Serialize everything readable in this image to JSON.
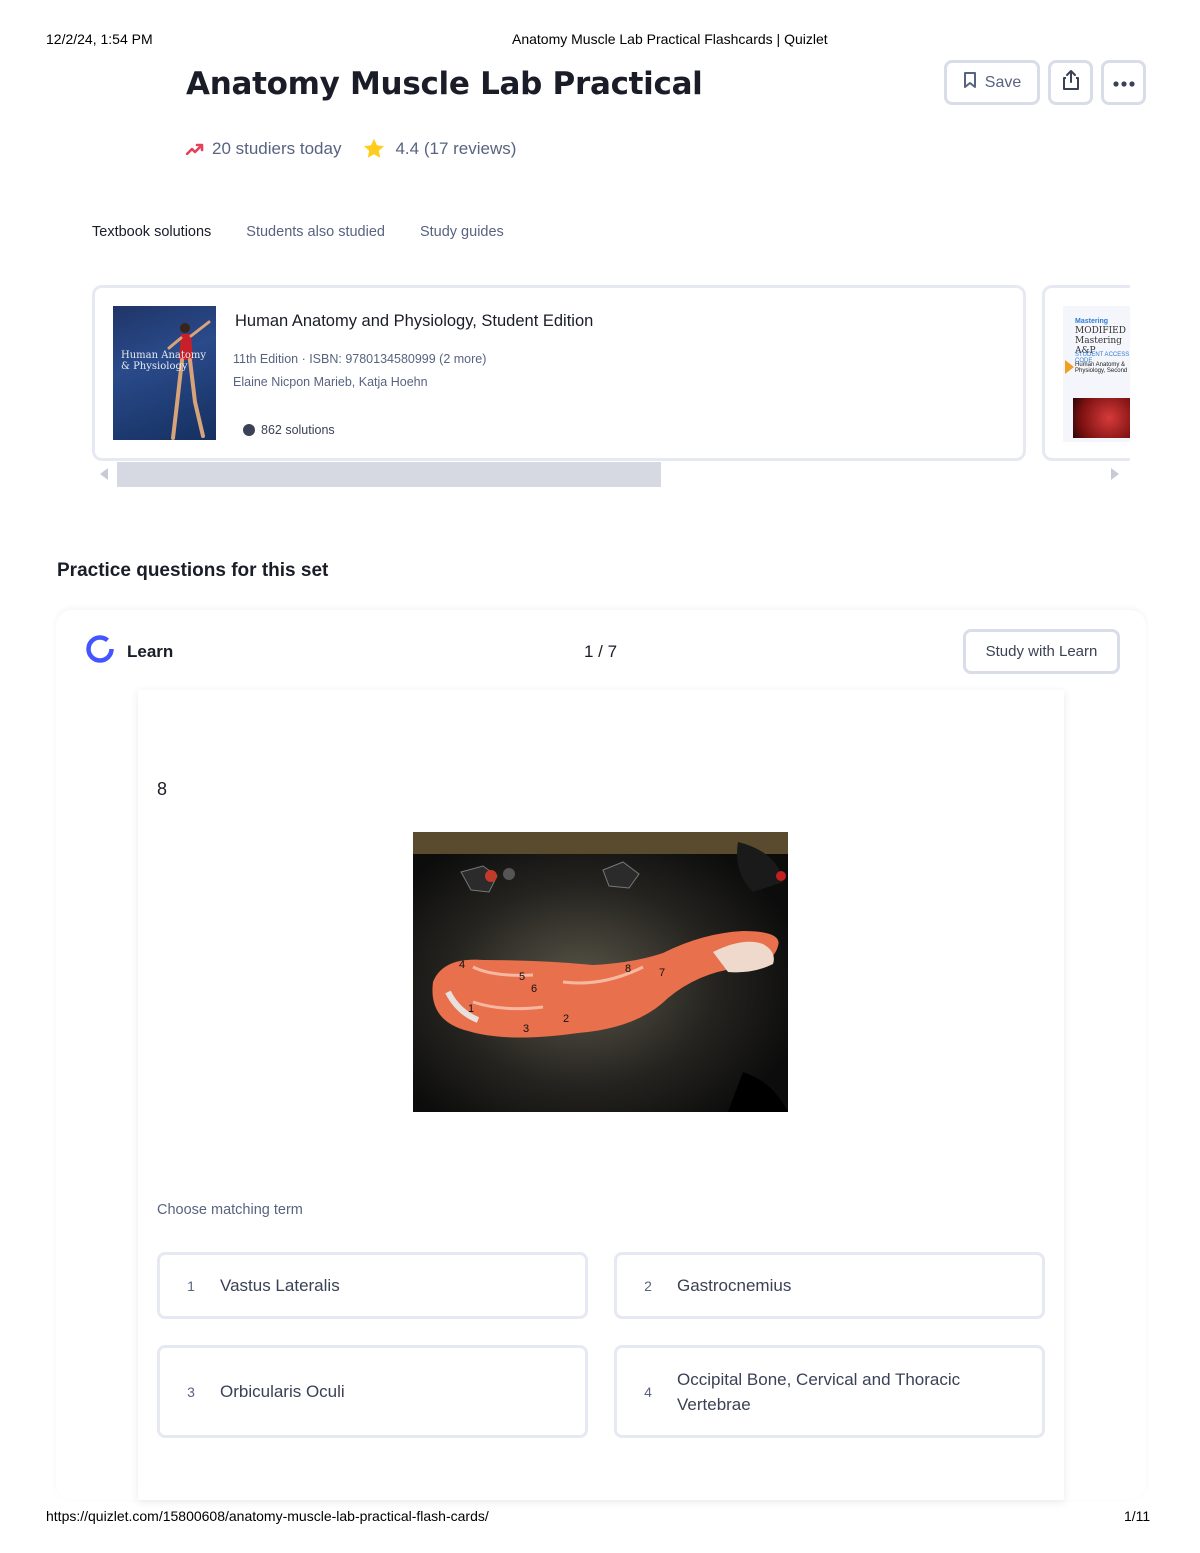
{
  "print_header": {
    "datetime": "12/2/24, 1:54 PM",
    "doc_title": "Anatomy Muscle Lab Practical Flashcards | Quizlet"
  },
  "print_footer": {
    "url": "https://quizlet.com/15800608/anatomy-muscle-lab-practical-flash-cards/",
    "page": "1/11"
  },
  "set": {
    "title": "Anatomy Muscle Lab Practical",
    "studiers": "20 studiers today",
    "rating": "4.4 (17 reviews)"
  },
  "actions": {
    "save_label": "Save",
    "share_icon": "share-icon",
    "more_icon": "more-dots-icon"
  },
  "tabs": [
    {
      "label": "Textbook solutions"
    },
    {
      "label": "Students also studied"
    },
    {
      "label": "Study guides"
    }
  ],
  "book": {
    "title": "Human Anatomy and Physiology, Student Edition",
    "meta": "11th Edition · ISBN: 9780134580999 (2 more)",
    "authors": "Elaine Nicpon Marieb, Katja Hoehn",
    "solutions": "862 solutions",
    "cover_text": "Human Anatomy & Physiology"
  },
  "book2": {
    "line1": "Mastering",
    "line2": "MODIFIED Mastering A&P",
    "line3": "STUDENT ACCESS CODE",
    "line4": "Human Anatomy & Physiology, Second"
  },
  "practice": {
    "section_title": "Practice questions for this set",
    "mode": "Learn",
    "counter": "1 / 7",
    "study_button": "Study with Learn",
    "question_number": "8",
    "choose_label": "Choose matching term",
    "options": [
      {
        "num": "1",
        "term": "Vastus Lateralis"
      },
      {
        "num": "2",
        "term": "Gastrocnemius"
      },
      {
        "num": "3",
        "term": "Orbicularis Oculi"
      },
      {
        "num": "4",
        "term": "Occipital Bone, Cervical and Thoracic Vertebrae"
      }
    ]
  },
  "colors": {
    "accent_blue": "#4255ff",
    "trend_red": "#e2415a",
    "star_yellow": "#ffcd1f",
    "border": "#d9dde8"
  }
}
